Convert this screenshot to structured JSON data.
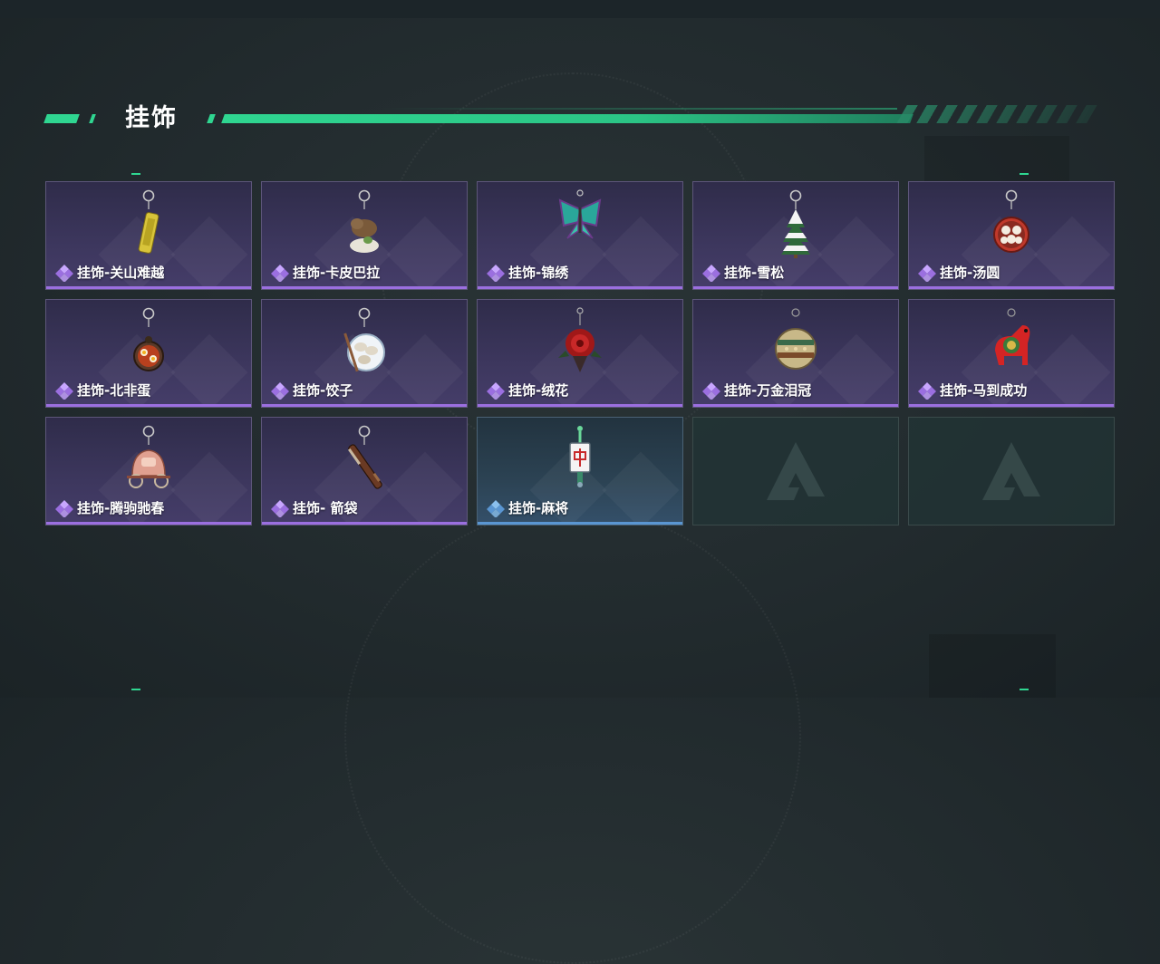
{
  "header": {
    "title": "挂饰"
  },
  "colors": {
    "accent": "#2fd691",
    "rare_purple": "#9b6fe0",
    "rare_blue": "#5a96d2"
  },
  "items": [
    {
      "label": "挂饰-关山难越",
      "rarity": "purple",
      "icon": "golden-cylinder-charm-icon"
    },
    {
      "label": "挂饰-卡皮巴拉",
      "rarity": "purple",
      "icon": "capybara-charm-icon"
    },
    {
      "label": "挂饰-锦绣",
      "rarity": "purple",
      "icon": "butterfly-charm-icon"
    },
    {
      "label": "挂饰-雪松",
      "rarity": "purple",
      "icon": "snowy-pine-charm-icon"
    },
    {
      "label": "挂饰-汤圆",
      "rarity": "purple",
      "icon": "tangyuan-bowl-charm-icon"
    },
    {
      "label": "挂饰-北非蛋",
      "rarity": "purple",
      "icon": "shakshuka-charm-icon"
    },
    {
      "label": "挂饰-饺子",
      "rarity": "purple",
      "icon": "dumpling-plate-charm-icon"
    },
    {
      "label": "挂饰-绒花",
      "rarity": "purple",
      "icon": "velvet-flower-charm-icon"
    },
    {
      "label": "挂饰-万金泪冠",
      "rarity": "purple",
      "icon": "golden-crown-charm-icon"
    },
    {
      "label": "挂饰-马到成功",
      "rarity": "purple",
      "icon": "red-horse-charm-icon"
    },
    {
      "label": "挂饰-腾驹驰春",
      "rarity": "purple",
      "icon": "carriage-charm-icon"
    },
    {
      "label": "挂饰- 箭袋",
      "rarity": "purple",
      "icon": "quiver-charm-icon"
    },
    {
      "label": "挂饰-麻将",
      "rarity": "blue",
      "icon": "mahjong-tile-charm-icon"
    }
  ],
  "empty_slots": 2
}
